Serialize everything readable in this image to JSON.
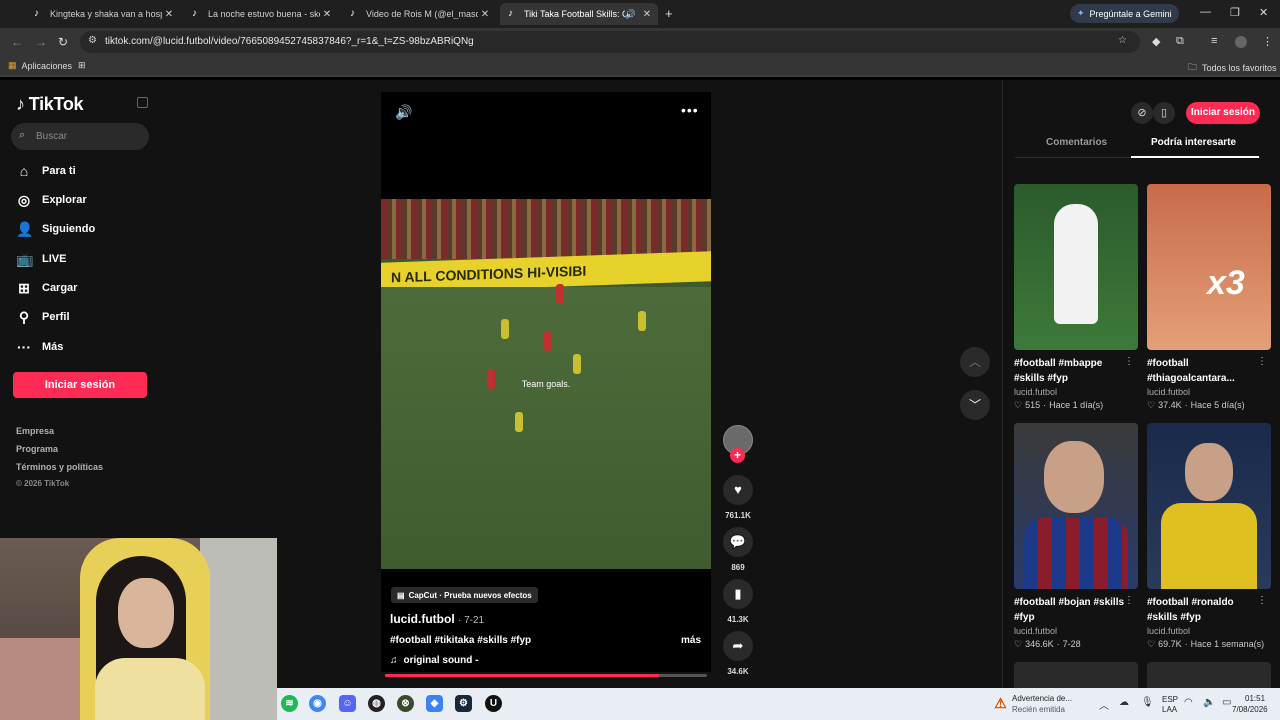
{
  "browser": {
    "tabs": [
      {
        "title": "Kingteka y shaka van a hospital"
      },
      {
        "title": "La noche estuvo buena - sketch"
      },
      {
        "title": "Video de Rois M (@el_masqsue"
      },
      {
        "title": "Tiki Taka Football Skills: Ch"
      }
    ],
    "new_tab": "+",
    "gemini_label": "Pregúntale a Gemini",
    "url": "tiktok.com/@lucid.futbol/video/7665089452745837846?_r=1&_t=ZS-98bzABRiQNg",
    "bookmarks": {
      "apps": "Aplicaciones",
      "all": "Todos los favoritos"
    }
  },
  "sidebar": {
    "logo": "TikTok",
    "search_placeholder": "Buscar",
    "nav": [
      {
        "label": "Para ti",
        "icon": "home-icon"
      },
      {
        "label": "Explorar",
        "icon": "compass-icon"
      },
      {
        "label": "Siguiendo",
        "icon": "following-icon"
      },
      {
        "label": "LIVE",
        "icon": "live-icon"
      },
      {
        "label": "Cargar",
        "icon": "upload-icon"
      },
      {
        "label": "Perfil",
        "icon": "profile-icon"
      },
      {
        "label": "Más",
        "icon": "more-icon"
      }
    ],
    "login": "Iniciar sesión",
    "footer": [
      "Empresa",
      "Programa",
      "Términos y políticas"
    ],
    "copyright": "© 2026 TikTok"
  },
  "video": {
    "ad_text": "N ALL CONDITIONS HI-VISIBI",
    "caption": "Team goals.",
    "capcut": "CapCut · Prueba nuevos efectos",
    "author": "lucid.futbol",
    "date": "· 7-21",
    "hashtags": "#football #tikitaka #skills #fyp",
    "more": "más",
    "sound": "original sound - ",
    "progress_pct": 85,
    "likes": "761.1K",
    "comments": "869",
    "saves": "41.3K",
    "shares": "34.6K"
  },
  "right_panel": {
    "login": "Iniciar sesión",
    "tabs": [
      "Comentarios",
      "Podría interesarte"
    ],
    "cards": [
      {
        "title": "#football #mbappe #skills #fyp",
        "author": "lucid.futbol",
        "likes": "515",
        "time": "Hace 1 día(s)"
      },
      {
        "title": "#football #thiagoalcantara...",
        "author": "lucid.futbol",
        "likes": "37.4K",
        "time": "Hace 5 día(s)",
        "overlay": "x3"
      },
      {
        "title": "#football #bojan #skills #fyp",
        "author": "lucid.futbol",
        "likes": "346.6K",
        "time": "7-28"
      },
      {
        "title": "#football #ronaldo #skills #fyp",
        "author": "lucid.futbol",
        "likes": "69.7K",
        "time": "Hace 1 semana(s)"
      }
    ]
  },
  "taskbar": {
    "alert_title": "Advertencia de...",
    "alert_sub": "Recién emitida",
    "lang_top": "ESP",
    "lang_bottom": "LAA",
    "time": "01:51",
    "date": "7/08/2026"
  },
  "colors": {
    "accent": "#fe2c55",
    "page_bg": "#121212"
  }
}
